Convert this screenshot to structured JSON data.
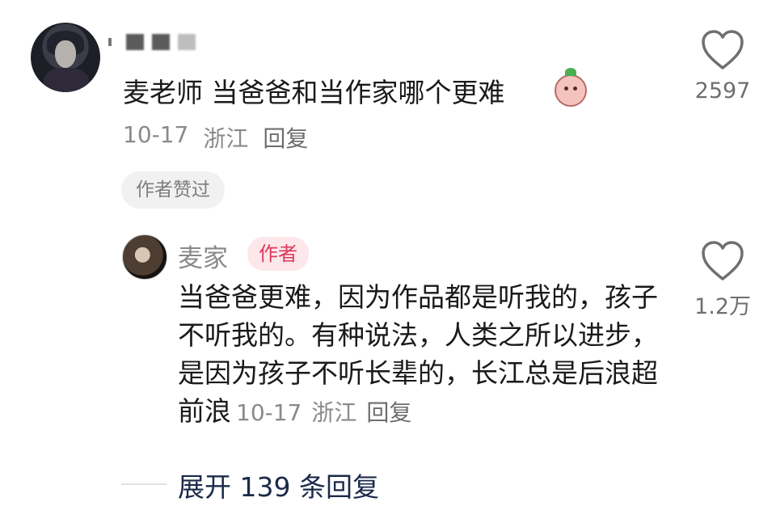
{
  "comment": {
    "text": "麦老师 当爸爸和当作家哪个更难",
    "date": "10-17",
    "location": "浙江",
    "reply_label": "回复",
    "likes": "2597",
    "author_liked_badge": "作者赞过",
    "emoji_icon": "peach-emoji-icon"
  },
  "reply": {
    "author": "麦家",
    "author_tag": "作者",
    "text": "当爸爸更难，因为作品都是听我的，孩子不听我的。有种说法，人类之所以进步，是因为孩子不听长辈的，长江总是后浪超前浪",
    "date": "10-17",
    "location": "浙江",
    "reply_label": "回复",
    "likes": "1.2万"
  },
  "expand": {
    "label": "展开 139 条回复"
  },
  "colors": {
    "author_tag_bg": "#fde7ea",
    "author_tag_text": "#e0385a",
    "expand_text": "#1b2a4a",
    "meta_text": "#8a8a8a"
  }
}
